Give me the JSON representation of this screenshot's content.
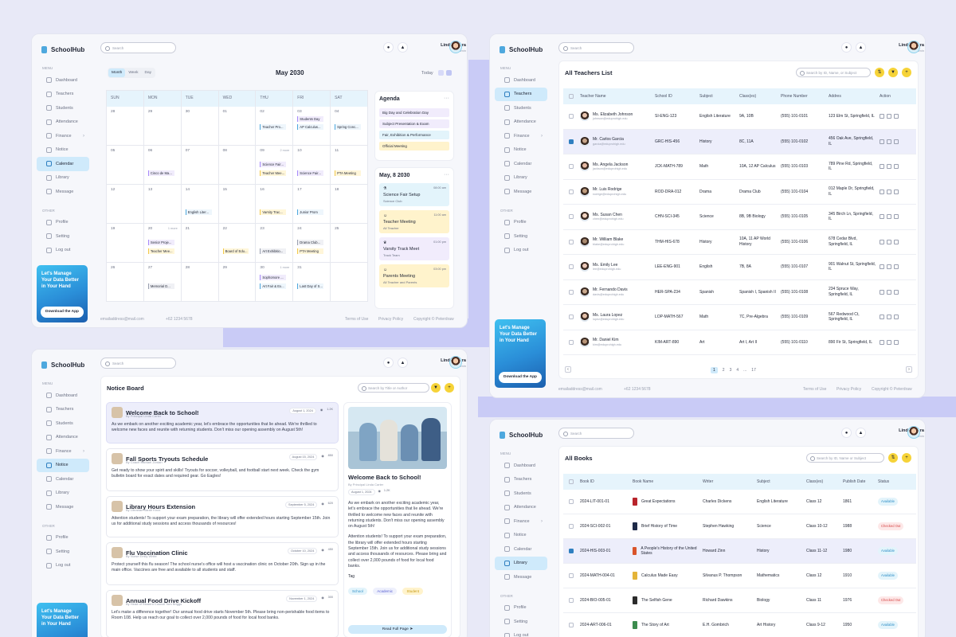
{
  "app": "SchoolHub",
  "user": {
    "name": "Linda Adora",
    "role": "Admin"
  },
  "search_placeholder": "Search",
  "menu": {
    "h1": "Menu",
    "h2": "Other",
    "items": [
      "Dashboard",
      "Teachers",
      "Students",
      "Attendance",
      "Finance",
      "Notice",
      "Calendar",
      "Library",
      "Message"
    ],
    "other": [
      "Profile",
      "Setting",
      "Log out"
    ]
  },
  "promo": {
    "text": "Let's Manage Your Data Better in Your Hand",
    "button": "Download the App"
  },
  "footer": {
    "email": "emailaddress@mail.com",
    "phone": "+62 1234 5678",
    "terms": "Terms of Use",
    "privacy": "Privacy Policy",
    "copy": "Copyright © Peterdraw"
  },
  "calendar": {
    "views": [
      "Month",
      "Week",
      "Day"
    ],
    "month": "May 2030",
    "today": "Today",
    "days": [
      "SUN",
      "MON",
      "TUE",
      "WED",
      "THU",
      "FRI",
      "SAT"
    ],
    "dates": [
      "28",
      "29",
      "30",
      "01",
      "02",
      "03",
      "04",
      "05",
      "06",
      "07",
      "08",
      "09",
      "10",
      "11",
      "12",
      "13",
      "14",
      "15",
      "16",
      "17",
      "18",
      "19",
      "20",
      "21",
      "22",
      "23",
      "24",
      "25",
      "26",
      "27",
      "28",
      "29",
      "30",
      "31"
    ],
    "events": {
      "thu1": "Teacher Pro...",
      "fri1a": "Students Day",
      "fri1b": "AP Calculus...",
      "sat1": "Spring Conc...",
      "more8": "2 more",
      "mon2": "Cinco de Ma...",
      "thu2a": "Science Fair...",
      "thu2b": "Teacher Mee...",
      "fri2": "Science Fair...",
      "sat2": "PTA Meeting",
      "tue3": "English Liter...",
      "thu3": "Varsity Trac...",
      "fri3": "Junior Prom",
      "more19": "1 more",
      "mon4a": "Senior Proje...",
      "mon4b": "Teacher Mee...",
      "wed4": "Board of Edu...",
      "thu4": "Art Exhibitio...",
      "fri4a": "Drama Club...",
      "fri4b": "PTA Meeting",
      "more29": "1 more",
      "mon5": "Memorial D...",
      "thu5a": "Sophomore ...",
      "thu5b": "Art Fair & Ex...",
      "fri5": "Last Day of S..."
    }
  },
  "agenda": {
    "title": "Agenda",
    "items": [
      "Big Day and Celebration Day",
      "Subject Presentation & Exam",
      "Fair, Exhibition & Performance",
      "Official Meeting"
    ],
    "date": "May, 8 2030",
    "cards": [
      {
        "t": "Science Fair Setup",
        "s": "Science Club",
        "time": "08:00 am"
      },
      {
        "t": "Teacher Meeting",
        "s": "All Teacher",
        "time": "11:00 am"
      },
      {
        "t": "Varsity Track Meet",
        "s": "Track Team",
        "time": "01:00 pm"
      },
      {
        "t": "Parents Meeting",
        "s": "All Teacher and Parents",
        "time": "03:00 pm"
      }
    ]
  },
  "teachers": {
    "title": "All Teachers List",
    "search": "Search by ID, Name, or Subject",
    "cols": [
      "Teacher Name",
      "School ID",
      "Subject",
      "Class(es)",
      "Phone Number",
      "Addres",
      "Action"
    ],
    "rows": [
      {
        "n": "Ms. Elizabeth Johnson",
        "e": "johnson@eduprohigh.edu",
        "id": "SI-ENG-123",
        "s": "English Literature",
        "c": "9A, 10B",
        "p": "(555) 101-0101",
        "a": "123 Elm St, Springfield, IL"
      },
      {
        "n": "Mr. Carlos Garcia",
        "e": "garcia@eduprohigh.edu",
        "id": "GRC-HIS-456",
        "s": "History",
        "c": "8C, 11A",
        "p": "(555) 101-0102",
        "a": "456 Oak Ave, Springfield, IL"
      },
      {
        "n": "Ms. Angela Jackson",
        "e": "jackson@eduprohigh.edu",
        "id": "JCK-MATH-789",
        "s": "Math",
        "c": "10A, 12 AP Calculus",
        "p": "(555) 101-0103",
        "a": "789 Pine Rd, Springfield, IL"
      },
      {
        "n": "Mr. Luis Rodrige",
        "e": "rodrige@eduprohigh.edu",
        "id": "ROD-DRA-012",
        "s": "Drama",
        "c": "Drama Club",
        "p": "(555) 101-0104",
        "a": "012 Maple Dr, Springfield, IL"
      },
      {
        "n": "Ms. Susan Chen",
        "e": "chen@eduprohigh.edu",
        "id": "CHN-SCI-345",
        "s": "Science",
        "c": "8B, 9B Biology",
        "p": "(555) 101-0105",
        "a": "345 Birch Ln, Springfield, IL"
      },
      {
        "n": "Mr. William Blake",
        "e": "blake@eduprohigh.edu",
        "id": "THM-HIS-678",
        "s": "History",
        "c": "10A, 11 AP World History",
        "p": "(555) 101-0106",
        "a": "678 Cedar Blvd, Springfield, IL"
      },
      {
        "n": "Ms. Emily Lee",
        "e": "lee@eduprohigh.edu",
        "id": "LEE-ENG-901",
        "s": "English",
        "c": "7B, 8A",
        "p": "(555) 101-0107",
        "a": "901 Walnut St, Springfield, IL"
      },
      {
        "n": "Mr. Fernando Davis",
        "e": "davis@eduprohigh.edu",
        "id": "HER-SPA-234",
        "s": "Spanish",
        "c": "Spanish I, Spanish II",
        "p": "(555) 101-0108",
        "a": "234 Spruce Way, Springfield, IL"
      },
      {
        "n": "Ms. Laura Lopez",
        "e": "lopez@eduprohigh.edu",
        "id": "LOP-MATH-567",
        "s": "Math",
        "c": "7C, Pre-Algebra",
        "p": "(555) 101-0109",
        "a": "567 Redwood Ct, Springfield, IL"
      },
      {
        "n": "Mr. Daniel Kim",
        "e": "kim@eduprohigh.edu",
        "id": "KIM-ART-890",
        "s": "Art",
        "c": "Art I, Art II",
        "p": "(555) 101-0110",
        "a": "890 Fir St, Springfield, IL"
      }
    ],
    "pages": [
      "1",
      "2",
      "3",
      "4",
      "...",
      "17"
    ]
  },
  "notice": {
    "title": "Notice Board",
    "search": "Search by Title or Author",
    "items": [
      {
        "t": "Welcome Back to School!",
        "by": "By Principal Linda Carter",
        "d": "August 1, 2024",
        "v": "1.2K",
        "b": "As we embark on another exciting academic year, let's embrace the opportunities that lie ahead. We're thrilled to welcome new faces and reunite with returning students. Don't miss our opening assembly on August 5th!"
      },
      {
        "t": "Fall Sports Tryouts Schedule",
        "by": "By Coach Michael Jordan",
        "d": "August 15, 2024",
        "v": "850",
        "b": "Get ready to show your spirit and skills! Tryouts for soccer, volleyball, and football start next week. Check the gym bulletin board for exact dates and required gear. Go Eagles!"
      },
      {
        "t": "Library Hours Extension",
        "by": "By Librarian Sarah Knox",
        "d": "September 5, 2024",
        "v": "620",
        "b": "Attention students! To support your exam preparation, the library will offer extended hours starting September 15th. Join us for additional study sessions and access thousands of resources!"
      },
      {
        "t": "Flu Vaccination Clinic",
        "by": "By Nurse Emily White",
        "d": "October 10, 2024",
        "v": "450",
        "b": "Protect yourself this flu season! The school nurse's office will host a vaccination clinic on October 20th. Sign up in the main office. Vaccines are free and available to all students and staff."
      },
      {
        "t": "Annual Food Drive Kickoff",
        "by": "By Head of Student Council Tom Briggs",
        "d": "November 1, 2024",
        "v": "300",
        "b": "Let's make a difference together! Our annual food drive starts November 5th. Please bring non-perishable food items to Room 108. Help us reach our goal to collect over 2,000 pounds of food for local food banks."
      }
    ],
    "detail": {
      "t": "Welcome Back to School!",
      "by": "By Principal Linda Carter",
      "d": "August 1, 2024",
      "v": "1.2K",
      "b1": "As we embark on another exciting academic year, let's embrace the opportunities that lie ahead. We're thrilled to welcome new faces and reunite with returning students. Don't miss our opening assembly on August 5th!",
      "b2": "Attention students! To support your exam preparation, the library will offer extended hours starting September 15th. Join us for additional study sessions and access thousands of resources. Please bring and collect over 2,000 pounds of food for local food banks.",
      "tag": "Tag",
      "tags": [
        "School",
        "Academic",
        "Student"
      ],
      "read": "Read Full Page"
    }
  },
  "books": {
    "title": "All Books",
    "search": "Search by ID, Name or Subject",
    "cols": [
      "Book ID",
      "Book Name",
      "Writer",
      "Subject",
      "Class(es)",
      "Publish Date",
      "Status"
    ],
    "rows": [
      {
        "id": "2024-LIT-001-01",
        "n": "Great Expectations",
        "w": "Charles Dickens",
        "s": "English Literature",
        "c": "Class 12",
        "y": "1861",
        "st": "Available",
        "col": "#B8242B"
      },
      {
        "id": "2024-SCI-002-01",
        "n": "Brief History of Time",
        "w": "Stephen Hawking",
        "s": "Science",
        "c": "Class 10-12",
        "y": "1988",
        "st": "Checked Out",
        "col": "#1E2A48"
      },
      {
        "id": "2024-HIS-003-01",
        "n": "A People's History of the United States",
        "w": "Howard Zinn",
        "s": "History",
        "c": "Class 11-12",
        "y": "1980",
        "st": "Available",
        "col": "#D9542A"
      },
      {
        "id": "2024-MATH-004-01",
        "n": "Calculus Made Easy",
        "w": "Silvanus P. Thompson",
        "s": "Mathematics",
        "c": "Class 12",
        "y": "1910",
        "st": "Available",
        "col": "#E4B438"
      },
      {
        "id": "2024-BIO-005-01",
        "n": "The Selfish Gene",
        "w": "Richard Dawkins",
        "s": "Biology",
        "c": "Class 11",
        "y": "1976",
        "st": "Checked Out",
        "col": "#2B2B2B"
      },
      {
        "id": "2024-ART-006-01",
        "n": "The Story of Art",
        "w": "E.H. Gombrich",
        "s": "Art History",
        "c": "Class 9-12",
        "y": "1950",
        "st": "Available",
        "col": "#3C8C4E"
      }
    ]
  }
}
